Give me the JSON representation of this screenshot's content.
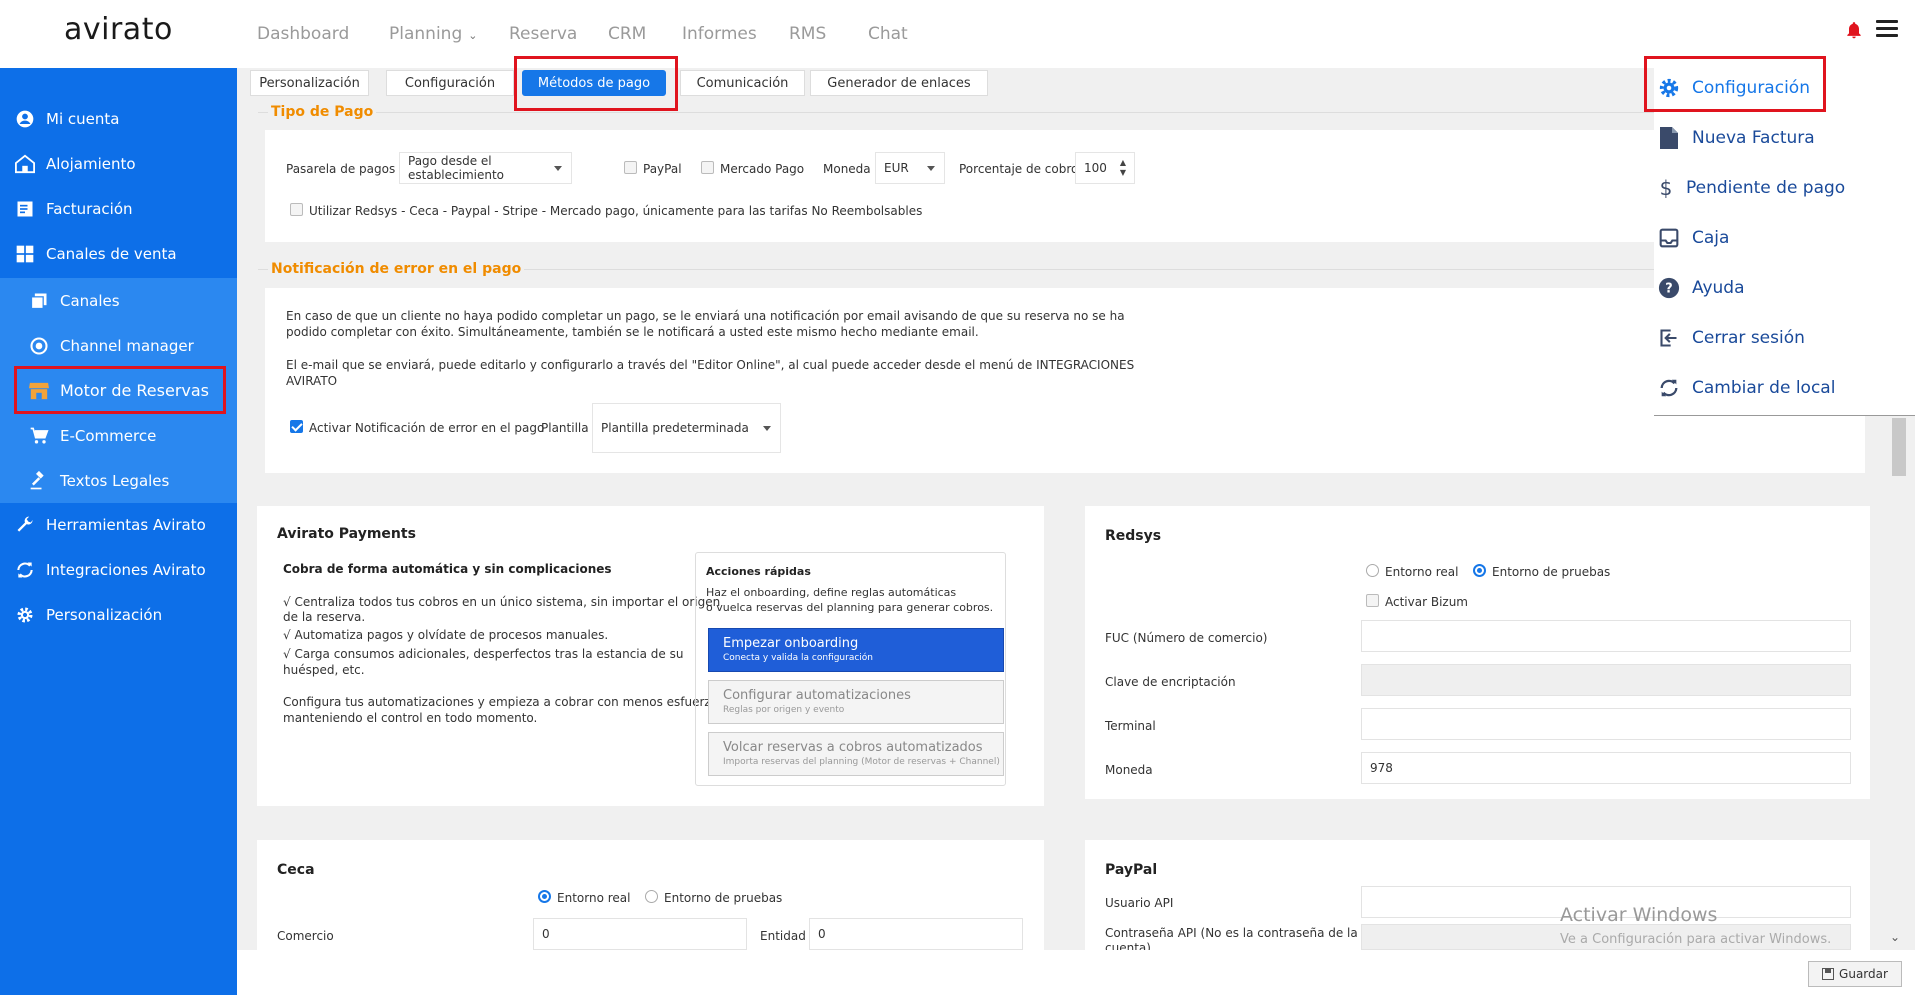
{
  "app": {
    "logo": "avirato"
  },
  "nav": [
    {
      "label": "Dashboard"
    },
    {
      "label": "Planning"
    },
    {
      "label": "Reserva"
    },
    {
      "label": "CRM"
    },
    {
      "label": "Informes"
    },
    {
      "label": "RMS"
    },
    {
      "label": "Chat"
    }
  ],
  "sidebar": {
    "items": [
      {
        "label": "Mi cuenta",
        "icon": "account-circle-icon"
      },
      {
        "label": "Alojamiento",
        "icon": "home-icon"
      },
      {
        "label": "Facturación",
        "icon": "invoice-icon"
      },
      {
        "label": "Canales de venta",
        "icon": "dashboard-icon"
      },
      {
        "label": "Canales",
        "icon": "copy-icon"
      },
      {
        "label": "Channel manager",
        "icon": "channel-icon"
      },
      {
        "label": "Motor de Reservas",
        "icon": "store-icon"
      },
      {
        "label": "E-Commerce",
        "icon": "cart-icon"
      },
      {
        "label": "Textos Legales",
        "icon": "gavel-icon"
      },
      {
        "label": "Herramientas Avirato",
        "icon": "wrench-icon"
      },
      {
        "label": "Integraciones Avirato",
        "icon": "sync-icon"
      },
      {
        "label": "Personalización",
        "icon": "gear-icon"
      }
    ]
  },
  "tabs": [
    {
      "label": "Personalización"
    },
    {
      "label": "Configuración"
    },
    {
      "label": "Métodos de pago"
    },
    {
      "label": "Comunicación"
    },
    {
      "label": "Generador de enlaces"
    }
  ],
  "tipo_pago": {
    "legend": "Tipo de Pago",
    "pasarela_label": "Pasarela de pagos",
    "pasarela_value": "Pago desde el establecimiento",
    "paypal": "PayPal",
    "mercado_pago": "Mercado Pago",
    "moneda_label": "Moneda",
    "moneda_value": "EUR",
    "porcentaje_label": "Porcentaje de cobro",
    "porcentaje_value": "100",
    "no_reembolsables": "Utilizar Redsys - Ceca - Paypal - Stripe - Mercado pago, únicamente para las tarifas No Reembolsables"
  },
  "notif": {
    "legend": "Notificación de error en el pago",
    "p1a": "En caso de que un cliente no haya podido completar un pago, se le enviará una notificación por email avisando de que su reserva no se ha",
    "p1b": "podido completar con éxito. Simultáneamente, también se le notificará a usted este mismo hecho mediante email.",
    "p2a": "El e-mail que se enviará, puede editarlo y configurarlo a través del \"Editor Online\", al cual puede acceder desde el menú de INTEGRACIONES",
    "p2b": "AVIRATO",
    "activar": "Activar Notificación de error en el pago",
    "plantilla_label": "Plantilla",
    "plantilla_value": "Plantilla predeterminada"
  },
  "avirato_payments": {
    "title": "Avirato Payments",
    "subtitle": "Cobra de forma automática y sin complicaciones",
    "b1a": "√ Centraliza todos tus cobros en un único sistema, sin importar el origen",
    "b1b": "de la reserva.",
    "b2": "√ Automatiza pagos y olvídate de procesos manuales.",
    "b3a": "√ Carga consumos adicionales, desperfectos tras la estancia de su",
    "b3b": "huésped, etc.",
    "f1": "Configura tus automatizaciones y empieza a cobrar con menos esfuerzo,",
    "f2": "manteniendo el control en todo momento.",
    "quick_title": "Acciones rápidas",
    "quick_desc1": "Haz el onboarding, define reglas automáticas",
    "quick_desc2": "o vuelca reservas del planning para generar cobros.",
    "btn1_title": "Empezar onboarding",
    "btn1_sub": "Conecta y valida la configuración",
    "btn2_title": "Configurar automatizaciones",
    "btn2_sub": "Reglas por origen y evento",
    "btn3_title": "Volcar reservas a cobros automatizados",
    "btn3_sub": "Importa reservas del planning (Motor de reservas + Channel)"
  },
  "redsys": {
    "title": "Redsys",
    "entorno_real": "Entorno real",
    "entorno_pruebas": "Entorno de pruebas",
    "bizum": "Activar Bizum",
    "fuc_label": "FUC (Número de comercio)",
    "clave_label": "Clave de encriptación",
    "terminal_label": "Terminal",
    "moneda_label": "Moneda",
    "moneda_value": "978"
  },
  "ceca": {
    "title": "Ceca",
    "entorno_real": "Entorno real",
    "entorno_pruebas": "Entorno de pruebas",
    "comercio_label": "Comercio",
    "comercio_value": "0",
    "entidad_label": "Entidad",
    "entidad_value": "0"
  },
  "paypal": {
    "title": "PayPal",
    "usuario_label": "Usuario API",
    "pass_label1": "Contraseña API (No es la contraseña de la",
    "pass_label2": "cuenta)"
  },
  "menu": {
    "items": [
      {
        "label": "Configuración",
        "icon": "gear-icon"
      },
      {
        "label": "Nueva Factura",
        "icon": "document-icon"
      },
      {
        "label": "Pendiente de pago",
        "icon": "dollar-icon"
      },
      {
        "label": "Caja",
        "icon": "inbox-icon"
      },
      {
        "label": "Ayuda",
        "icon": "help-icon"
      },
      {
        "label": "Cerrar sesión",
        "icon": "logout-icon"
      },
      {
        "label": "Cambiar de local",
        "icon": "refresh-icon"
      }
    ]
  },
  "watermark": {
    "line1": "Activar Windows",
    "line2": "Ve a Configuración para activar Windows."
  },
  "footer": {
    "save": "Guardar"
  },
  "colors": {
    "sidebar": "#0d6fe8",
    "accent": "#1677e8",
    "highlight": "#e0141e",
    "legend": "#f08c00"
  }
}
